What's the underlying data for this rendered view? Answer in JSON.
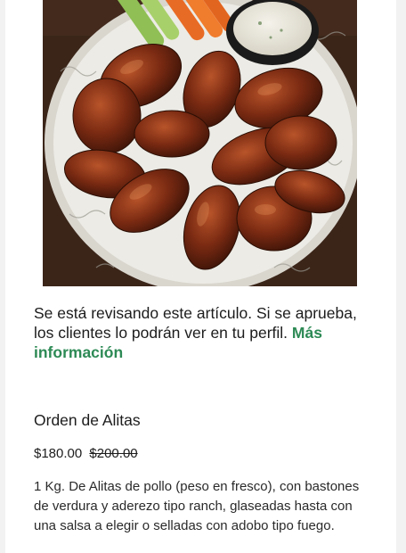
{
  "item_image": {
    "subject": "wings-platter-photo"
  },
  "review_notice": {
    "text": "Se está revisando este artículo. Si se aprueba, los clientes lo podrán ver en tu perfil.",
    "link_label": "Más información"
  },
  "product": {
    "name": "Orden de Alitas",
    "price": "$180.00",
    "original_price": "$200.00",
    "description": "1 Kg. De Alitas de pollo (peso en fresco), con bastones de verdura y aderezo tipo ranch, glaseadas hasta con una salsa a elegir o selladas con adobo tipo fuego."
  },
  "colors": {
    "link": "#2d8a55",
    "text": "#1c1c1c"
  }
}
